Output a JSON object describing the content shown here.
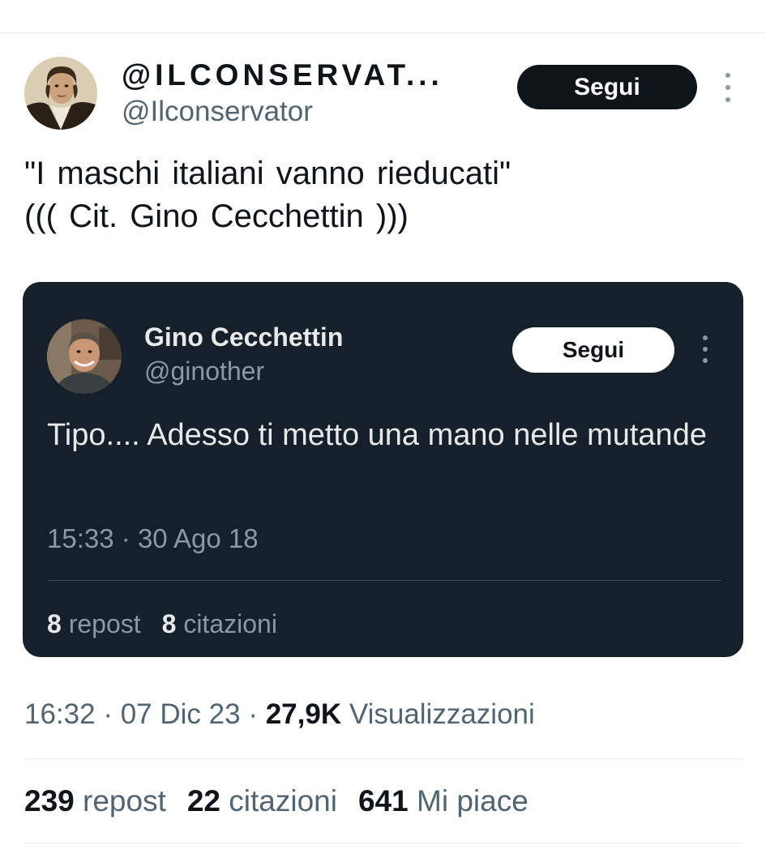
{
  "tweet": {
    "display_name": "@ILCONSERVAT...",
    "handle": "@Ilconservator",
    "follow_label": "Segui",
    "text": "\"I maschi italiani vanno rieducati\"\n((( Cit. Gino  Cecchettin )))",
    "time": "16:32",
    "date": "07 Dic 23",
    "views": "27,9K",
    "views_label": "Visualizzazioni",
    "separator": "·",
    "reposts": "239",
    "reposts_label": "repost",
    "quotes": "22",
    "quotes_label": "citazioni",
    "likes": "641",
    "likes_label": "Mi piace"
  },
  "quoted": {
    "display_name": "Gino Cecchettin",
    "handle": "@ginother",
    "follow_label": "Segui",
    "text": "Tipo.... Adesso ti metto una mano nelle mutande",
    "time": "15:33",
    "date": "30 Ago 18",
    "separator": "·",
    "reposts": "8",
    "reposts_label": "repost",
    "quotes": "8",
    "quotes_label": "citazioni"
  },
  "icons": {
    "more": "more-vertical-icon"
  },
  "colors": {
    "text_primary": "#0f1419",
    "text_secondary": "#536471",
    "quote_bg": "#15202b",
    "follow_bg": "#0f1419"
  }
}
